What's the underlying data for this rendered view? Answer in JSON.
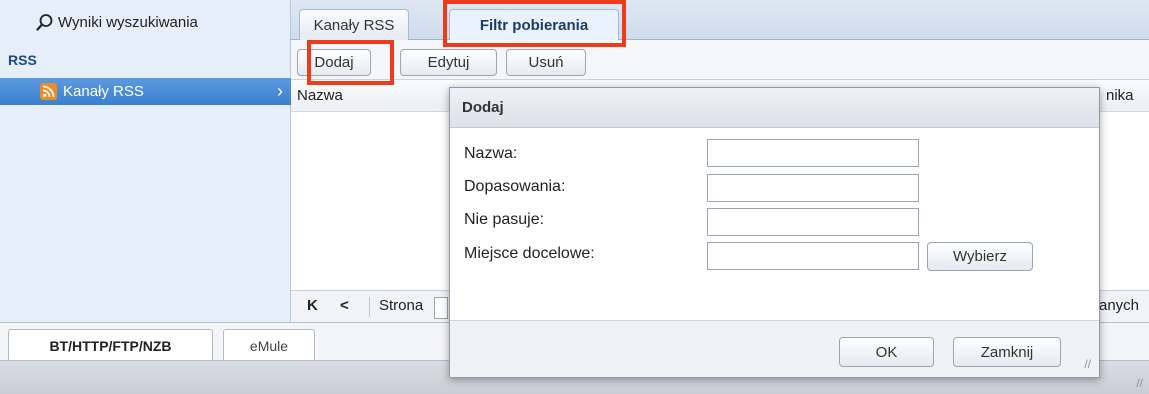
{
  "sidebar": {
    "search_label": "Wyniki wyszukiwania",
    "search_icon": "search-icon",
    "section_title": "RSS",
    "items": [
      {
        "label": "Kanały RSS",
        "icon": "rss-icon",
        "selected": true
      }
    ]
  },
  "tabs": [
    {
      "label": "Kanały RSS",
      "active": false
    },
    {
      "label": "Filtr pobierania",
      "active": true
    }
  ],
  "toolbar": {
    "add_label": "Dodaj",
    "edit_label": "Edytuj",
    "delete_label": "Usuń"
  },
  "grid": {
    "columns": [
      "Nazwa",
      "nika"
    ]
  },
  "pager": {
    "first_glyph": "K",
    "prev_glyph": "<",
    "page_label": "Strona",
    "right_text": "anych"
  },
  "bottom_tabs": [
    {
      "label": "BT/HTTP/FTP/NZB",
      "active": true
    },
    {
      "label": "eMule",
      "active": false
    }
  ],
  "dialog": {
    "title": "Dodaj",
    "fields": [
      {
        "label": "Nazwa:",
        "value": ""
      },
      {
        "label": "Dopasowania:",
        "value": ""
      },
      {
        "label": "Nie pasuje:",
        "value": ""
      },
      {
        "label": "Miejsce docelowe:",
        "value": ""
      }
    ],
    "choose_label": "Wybierz",
    "ok_label": "OK",
    "close_label": "Zamknij"
  },
  "colors": {
    "highlight": "#ee3b1c",
    "selection": "#4a8bd6",
    "rss_orange": "#f08a24"
  }
}
